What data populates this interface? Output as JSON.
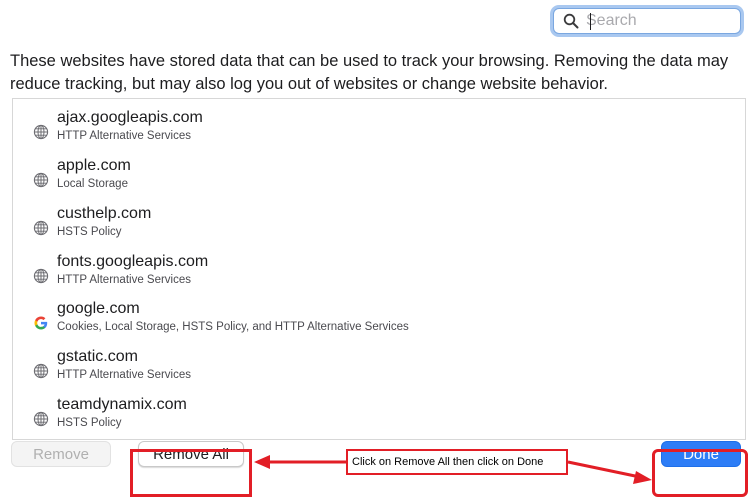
{
  "search": {
    "placeholder": "Search",
    "icon": "search-icon"
  },
  "description": "These websites have stored data that can be used to track your browsing. Removing the data may reduce tracking, but may also log you out of websites or change website behavior.",
  "websites": [
    {
      "name": "ajax.googleapis.com",
      "data": "HTTP Alternative Services",
      "icon": "globe-icon"
    },
    {
      "name": "apple.com",
      "data": "Local Storage",
      "icon": "globe-icon"
    },
    {
      "name": "custhelp.com",
      "data": "HSTS Policy",
      "icon": "globe-icon"
    },
    {
      "name": "fonts.googleapis.com",
      "data": "HTTP Alternative Services",
      "icon": "globe-icon"
    },
    {
      "name": "google.com",
      "data": "Cookies, Local Storage, HSTS Policy, and HTTP Alternative Services",
      "icon": "google-icon"
    },
    {
      "name": "gstatic.com",
      "data": "HTTP Alternative Services",
      "icon": "globe-icon"
    },
    {
      "name": "teamdynamix.com",
      "data": "HSTS Policy",
      "icon": "globe-icon"
    }
  ],
  "buttons": {
    "remove": "Remove",
    "remove_all": "Remove All",
    "done": "Done"
  },
  "annotation": {
    "text": "Click on Remove All then click on Done",
    "color": "#e21e26"
  },
  "colors": {
    "accent": "#2d7df6",
    "focus_ring": "#a9c8f0"
  }
}
